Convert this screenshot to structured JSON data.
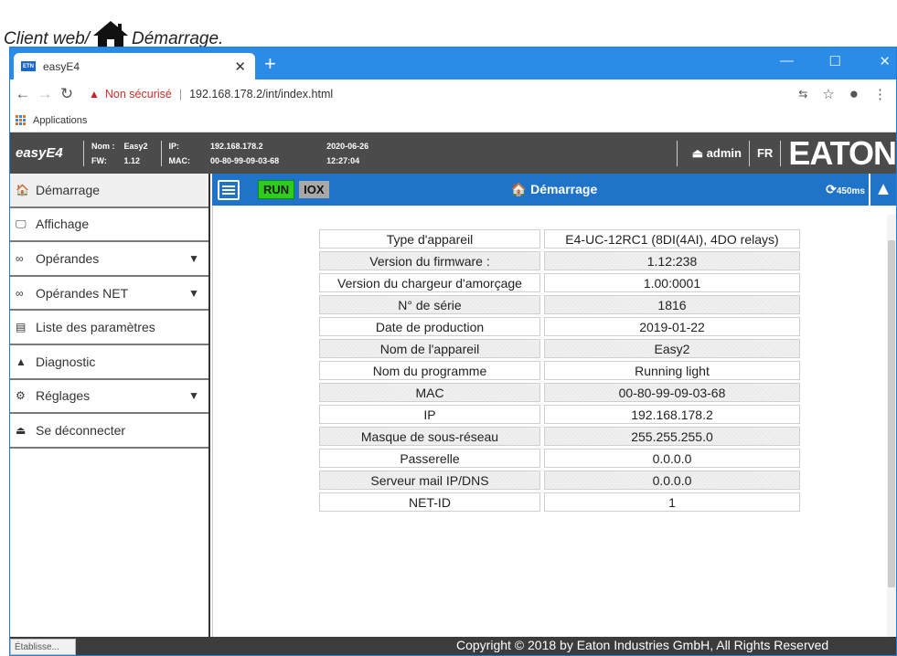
{
  "caption": {
    "left": "Client web/",
    "right": "Démarrage."
  },
  "browser": {
    "tab_title": "easyE4",
    "tab_favicon": "ETN",
    "insecure_label": "Non sécurisé",
    "url": "192.168.178.2/int/index.html",
    "bookmark_label": "Applications"
  },
  "header": {
    "brand": "easyE4",
    "nom_label": "Nom :",
    "nom_value": "Easy2",
    "fw_label": "FW:",
    "fw_value": "1.12",
    "ip_label": "IP:",
    "ip_value": "192.168.178.2",
    "mac_label": "MAC:",
    "mac_value": "00-80-99-09-03-68",
    "date": "2020-06-26",
    "time": "12:27:04",
    "user": "admin",
    "lang": "FR",
    "company_logo": "EATON"
  },
  "sidebar": {
    "items": [
      {
        "label": "Démarrage",
        "icon": "home-icon",
        "glyph": "🏠"
      },
      {
        "label": "Affichage",
        "icon": "monitor-icon",
        "glyph": "🖵"
      },
      {
        "label": "Opérandes",
        "icon": "infinity-icon",
        "glyph": "∞"
      },
      {
        "label": "Opérandes NET",
        "icon": "infinity-icon",
        "glyph": "∞"
      },
      {
        "label": "Liste des paramètres",
        "icon": "list-icon",
        "glyph": "▤"
      },
      {
        "label": "Diagnostic",
        "icon": "warning-icon",
        "glyph": "▲"
      },
      {
        "label": "Réglages",
        "icon": "gear-icon",
        "glyph": "⚙"
      },
      {
        "label": "Se déconnecter",
        "icon": "user-icon",
        "glyph": "⏏"
      }
    ]
  },
  "toolbar": {
    "run_label": "RUN",
    "iox_label": "IOX",
    "title": "Démarrage",
    "cycle": "450ms",
    "run_color": "#2ecc1c",
    "accent": "#1f74c9"
  },
  "info_table": {
    "rows": [
      {
        "key": "Type d'appareil",
        "value": "E4-UC-12RC1 (8DI(4AI), 4DO relays)"
      },
      {
        "key": "Version du firmware :",
        "value": "1.12:238"
      },
      {
        "key": "Version du chargeur d'amorçage",
        "value": "1.00:0001"
      },
      {
        "key": "N° de série",
        "value": "1816"
      },
      {
        "key": "Date de production",
        "value": "2019-01-22"
      },
      {
        "key": "Nom de l'appareil",
        "value": "Easy2"
      },
      {
        "key": "Nom du programme",
        "value": "Running light"
      },
      {
        "key": "MAC",
        "value": "00-80-99-09-03-68"
      },
      {
        "key": "IP",
        "value": "192.168.178.2"
      },
      {
        "key": "Masque de sous-réseau",
        "value": "255.255.255.0"
      },
      {
        "key": "Passerelle",
        "value": "0.0.0.0"
      },
      {
        "key": "Serveur mail IP/DNS",
        "value": "0.0.0.0"
      },
      {
        "key": "NET-ID",
        "value": "1"
      }
    ]
  },
  "footer": {
    "copyright": "Copyright © 2018 by Eaton Industries GmbH, All Rights Reserved"
  },
  "status_bar": {
    "text": "Établisse..."
  }
}
